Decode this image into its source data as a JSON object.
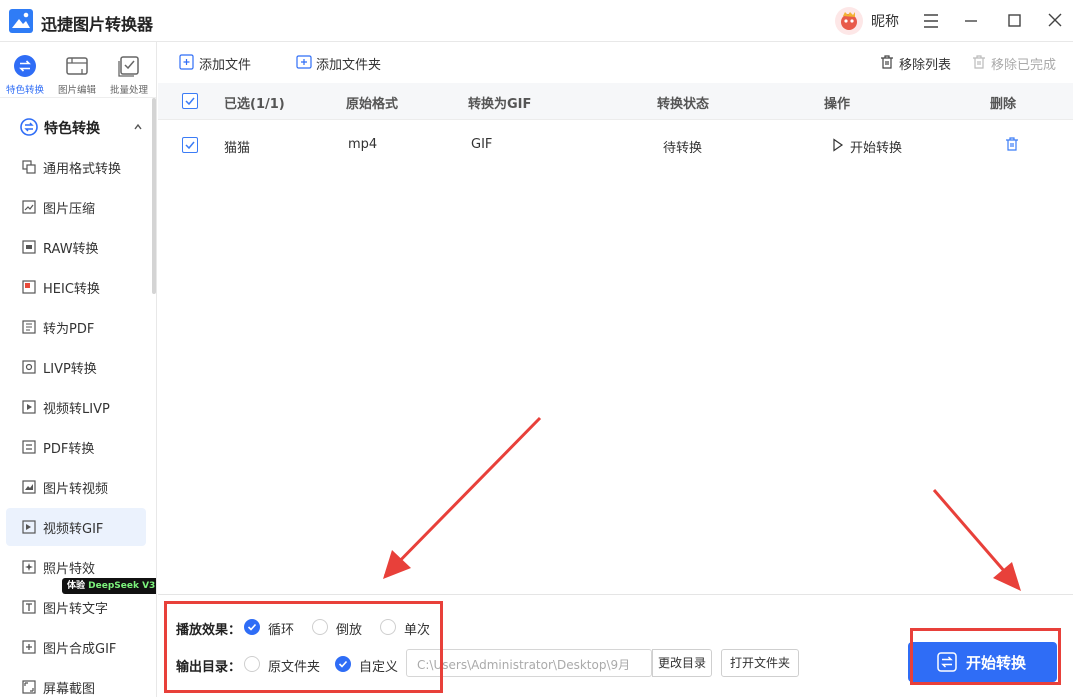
{
  "app": {
    "title": "迅捷图片转换器",
    "nickname": "昵称"
  },
  "mode_tabs": [
    {
      "label": "特色转换",
      "icon": "swap-icon",
      "active": true
    },
    {
      "label": "图片编辑",
      "icon": "image-edit-icon",
      "active": false
    },
    {
      "label": "批量处理",
      "icon": "batch-icon",
      "active": false
    }
  ],
  "sidebar": {
    "section_title": "特色转换",
    "items": [
      {
        "label": "通用格式转换",
        "icon": "format-convert-icon"
      },
      {
        "label": "图片压缩",
        "icon": "compress-icon"
      },
      {
        "label": "RAW转换",
        "icon": "raw-icon"
      },
      {
        "label": "HEIC转换",
        "icon": "heic-icon"
      },
      {
        "label": "转为PDF",
        "icon": "pdf-icon"
      },
      {
        "label": "LIVP转换",
        "icon": "livp-icon"
      },
      {
        "label": "视频转LIVP",
        "icon": "video-livp-icon"
      },
      {
        "label": "PDF转换",
        "icon": "pdf-convert-icon"
      },
      {
        "label": "图片转视频",
        "icon": "image-video-icon"
      },
      {
        "label": "视频转GIF",
        "icon": "video-gif-icon",
        "active": true
      },
      {
        "label": "照片特效",
        "icon": "photo-effect-icon"
      },
      {
        "label": "图片转文字",
        "icon": "ocr-icon"
      },
      {
        "label": "图片合成GIF",
        "icon": "gif-compose-icon"
      },
      {
        "label": "屏幕截图",
        "icon": "screenshot-icon"
      }
    ],
    "badge": {
      "prefix": "体验",
      "text": "DeepSeek V3"
    }
  },
  "toolbar": {
    "add_file": "添加文件",
    "add_folder": "添加文件夹",
    "remove_list": "移除列表",
    "remove_done": "移除已完成"
  },
  "table": {
    "headers": {
      "selected": "已选(1/1)",
      "format": "原始格式",
      "target": "转换为GIF",
      "status": "转换状态",
      "action": "操作",
      "delete": "删除"
    },
    "rows": [
      {
        "name": "猫猫",
        "format": "mp4",
        "target": "GIF",
        "status": "待转换",
        "action": "开始转换"
      }
    ]
  },
  "options": {
    "play_label": "播放效果：",
    "play_options": [
      "循环",
      "倒放",
      "单次"
    ],
    "play_selected": "循环",
    "output_label": "输出目录：",
    "output_options": [
      "原文件夹",
      "自定义"
    ],
    "output_selected": "自定义",
    "output_path": "C:\\Users\\Administrator\\Desktop\\9月",
    "change_dir": "更改目录",
    "open_folder": "打开文件夹"
  },
  "start_button": "开始转换",
  "colors": {
    "accent": "#2f6df6",
    "annotation": "#e8403a"
  }
}
